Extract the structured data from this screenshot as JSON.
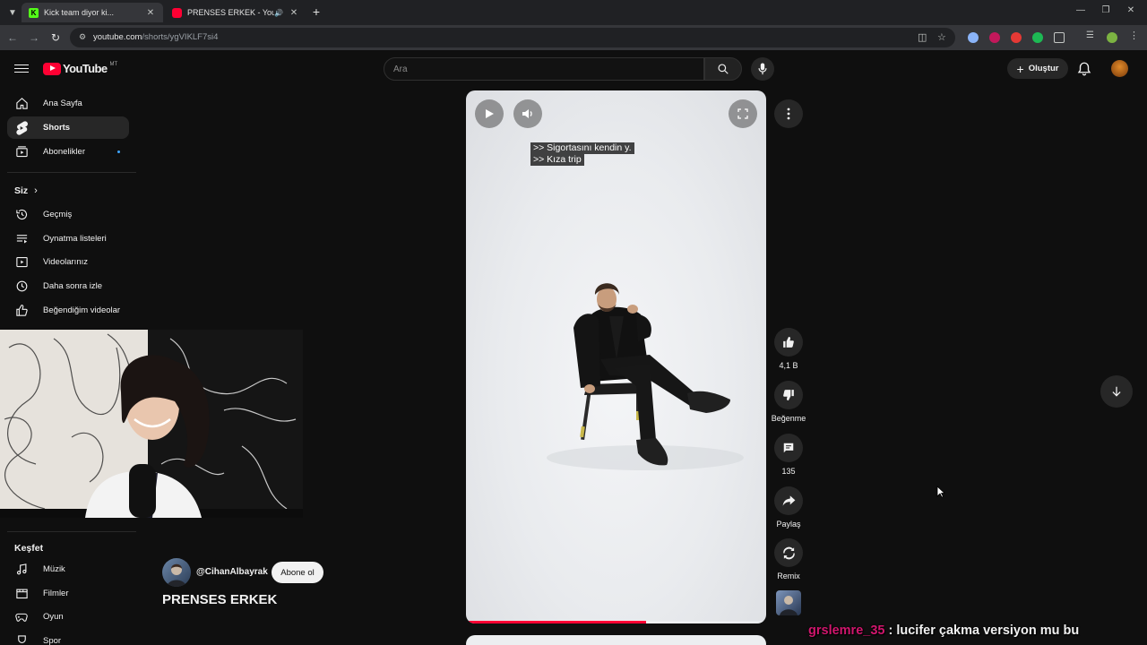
{
  "browser": {
    "tabs": [
      {
        "title": "Kick team diyor ki...",
        "favicon": "kick-icon",
        "active": true
      },
      {
        "title": "PRENSES ERKEK - YouTube",
        "favicon": "youtube-icon",
        "audio": true,
        "active": false
      }
    ],
    "url_host": "youtube.com",
    "url_path": "/shorts/ygVIKLF7si4"
  },
  "header": {
    "logo_text": "YouTube",
    "country_code": "MT",
    "search_placeholder": "Ara",
    "create_label": "Oluştur"
  },
  "sidebar": {
    "main": [
      {
        "label": "Ana Sayfa",
        "icon": "home-icon"
      },
      {
        "label": "Shorts",
        "icon": "shorts-icon",
        "active": true
      },
      {
        "label": "Abonelikler",
        "icon": "subscriptions-icon"
      }
    ],
    "you_heading": "Siz",
    "you": [
      {
        "label": "Geçmiş",
        "icon": "history-icon"
      },
      {
        "label": "Oynatma listeleri",
        "icon": "playlists-icon"
      },
      {
        "label": "Videolarınız",
        "icon": "your-videos-icon"
      },
      {
        "label": "Daha sonra izle",
        "icon": "watch-later-icon"
      },
      {
        "label": "Beğendiğim videolar",
        "icon": "liked-videos-icon"
      }
    ],
    "explore_heading": "Keşfet",
    "explore": [
      {
        "label": "Müzik",
        "icon": "music-icon"
      },
      {
        "label": "Filmler",
        "icon": "movies-icon"
      },
      {
        "label": "Oyun",
        "icon": "gaming-icon"
      },
      {
        "label": "Spor",
        "icon": "sports-icon"
      }
    ]
  },
  "short": {
    "channel": "@CihanAlbayrak",
    "subscribe_label": "Abone ol",
    "title": "PRENSES ERKEK",
    "captions": [
      ">> Sigortasını kendin y.",
      ">> Kıza trip"
    ],
    "progress": 0.6
  },
  "actions": {
    "like_count": "4,1 B",
    "dislike_label": "Beğenme",
    "comment_count": "135",
    "share_label": "Paylaş",
    "remix_label": "Remix"
  },
  "chat": {
    "user": "grslemre_35",
    "message": ": lucifer çakma versiyon mu bu"
  },
  "colors": {
    "accent": "#ff0033",
    "background": "#0f0f0f",
    "chat_user": "#d0166d"
  }
}
